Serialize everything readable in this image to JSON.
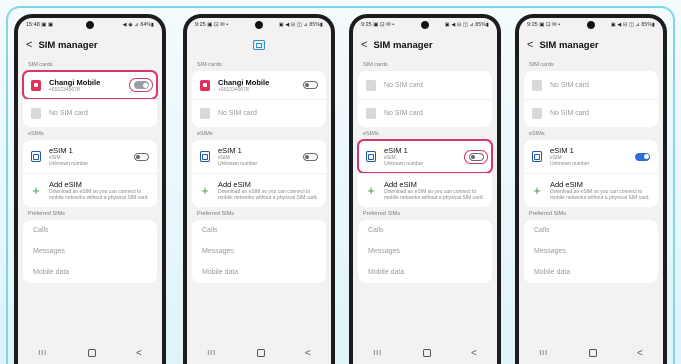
{
  "phones": [
    {
      "status_time": "15:48",
      "status_left_icons": "▣ ▣",
      "status_right": "◀ ◉ ⊿ 84%▮",
      "title": "SIM manager",
      "sim_cards_label": "SIM cards",
      "sim1_name": "Changi Mobile",
      "sim1_number": "+6512345678",
      "sim2_name": "No SIM card",
      "esims_label": "eSIMs",
      "esim_name": "eSIM 1",
      "esim_type": "eSIM",
      "esim_number": "Unknown number",
      "add_esim_title": "Add eSIM",
      "add_esim_desc": "Download an eSIM so you can connect to mobile networks without a physical SIM card.",
      "preferred_label": "Preferred SIMs",
      "pref_calls": "Calls",
      "pref_messages": "Messages",
      "pref_mobile_data": "Mobile data"
    },
    {
      "status_time": "9:25",
      "status_left_icons": "▣ ⊡ ✉ •",
      "status_right": "▣ ◀ ⊟ ◫ ⊿ 85%▮",
      "sim_cards_label": "SIM cards",
      "sim1_name": "Changi Mobile",
      "sim1_number": "+6512345678",
      "sim2_name": "No SIM card",
      "esims_label": "eSIMs",
      "esim_name": "eSIM 1",
      "esim_type": "eSIM",
      "esim_number": "Unknown number",
      "add_esim_title": "Add eSIM",
      "add_esim_desc": "Download an eSIM so you can connect to mobile networks without a physical SIM card.",
      "preferred_label": "Preferred SIMs",
      "pref_calls": "Calls",
      "pref_messages": "Messages",
      "pref_mobile_data": "Mobile data"
    },
    {
      "status_time": "9:25",
      "status_left_icons": "▣ ⊡ ✉ •",
      "status_right": "▣ ◀ ⊟ ◫ ⊿ 85%▮",
      "title": "SIM manager",
      "sim_cards_label": "SIM cards",
      "sim1_name": "No SIM card",
      "sim2_name": "No SIM card",
      "esims_label": "eSIMs",
      "esim_name": "eSIM 1",
      "esim_type": "eSIM",
      "esim_number": "Unknown number",
      "add_esim_title": "Add eSIM",
      "add_esim_desc": "Download an eSIM so you can connect to mobile networks without a physical SIM card.",
      "preferred_label": "Preferred SIMs",
      "pref_calls": "Calls",
      "pref_messages": "Messages",
      "pref_mobile_data": "Mobile data"
    },
    {
      "status_time": "9:25",
      "status_left_icons": "▣ ⊡ ✉ •",
      "status_right": "▣ ◀ ⊟ ◫ ⊿ 85%▮",
      "title": "SIM manager",
      "sim_cards_label": "SIM cards",
      "sim1_name": "No SIM card",
      "sim2_name": "No SIM card",
      "esims_label": "eSIMs",
      "esim_name": "eSIM 1",
      "esim_type": "eSIM",
      "esim_number": "Unknown number",
      "add_esim_title": "Add eSIM",
      "add_esim_desc": "Download an eSIM so you can connect to mobile networks without a physical SIM card.",
      "preferred_label": "Preferred SIMs",
      "pref_calls": "Calls",
      "pref_messages": "Messages",
      "pref_mobile_data": "Mobile data"
    }
  ],
  "nav": {
    "recent": "III",
    "back": "<"
  },
  "colors": {
    "highlight": "#d7356e",
    "accent_blue": "#2f6fd6",
    "sim_red": "#e0315d",
    "frame": "#7fd6ec"
  }
}
